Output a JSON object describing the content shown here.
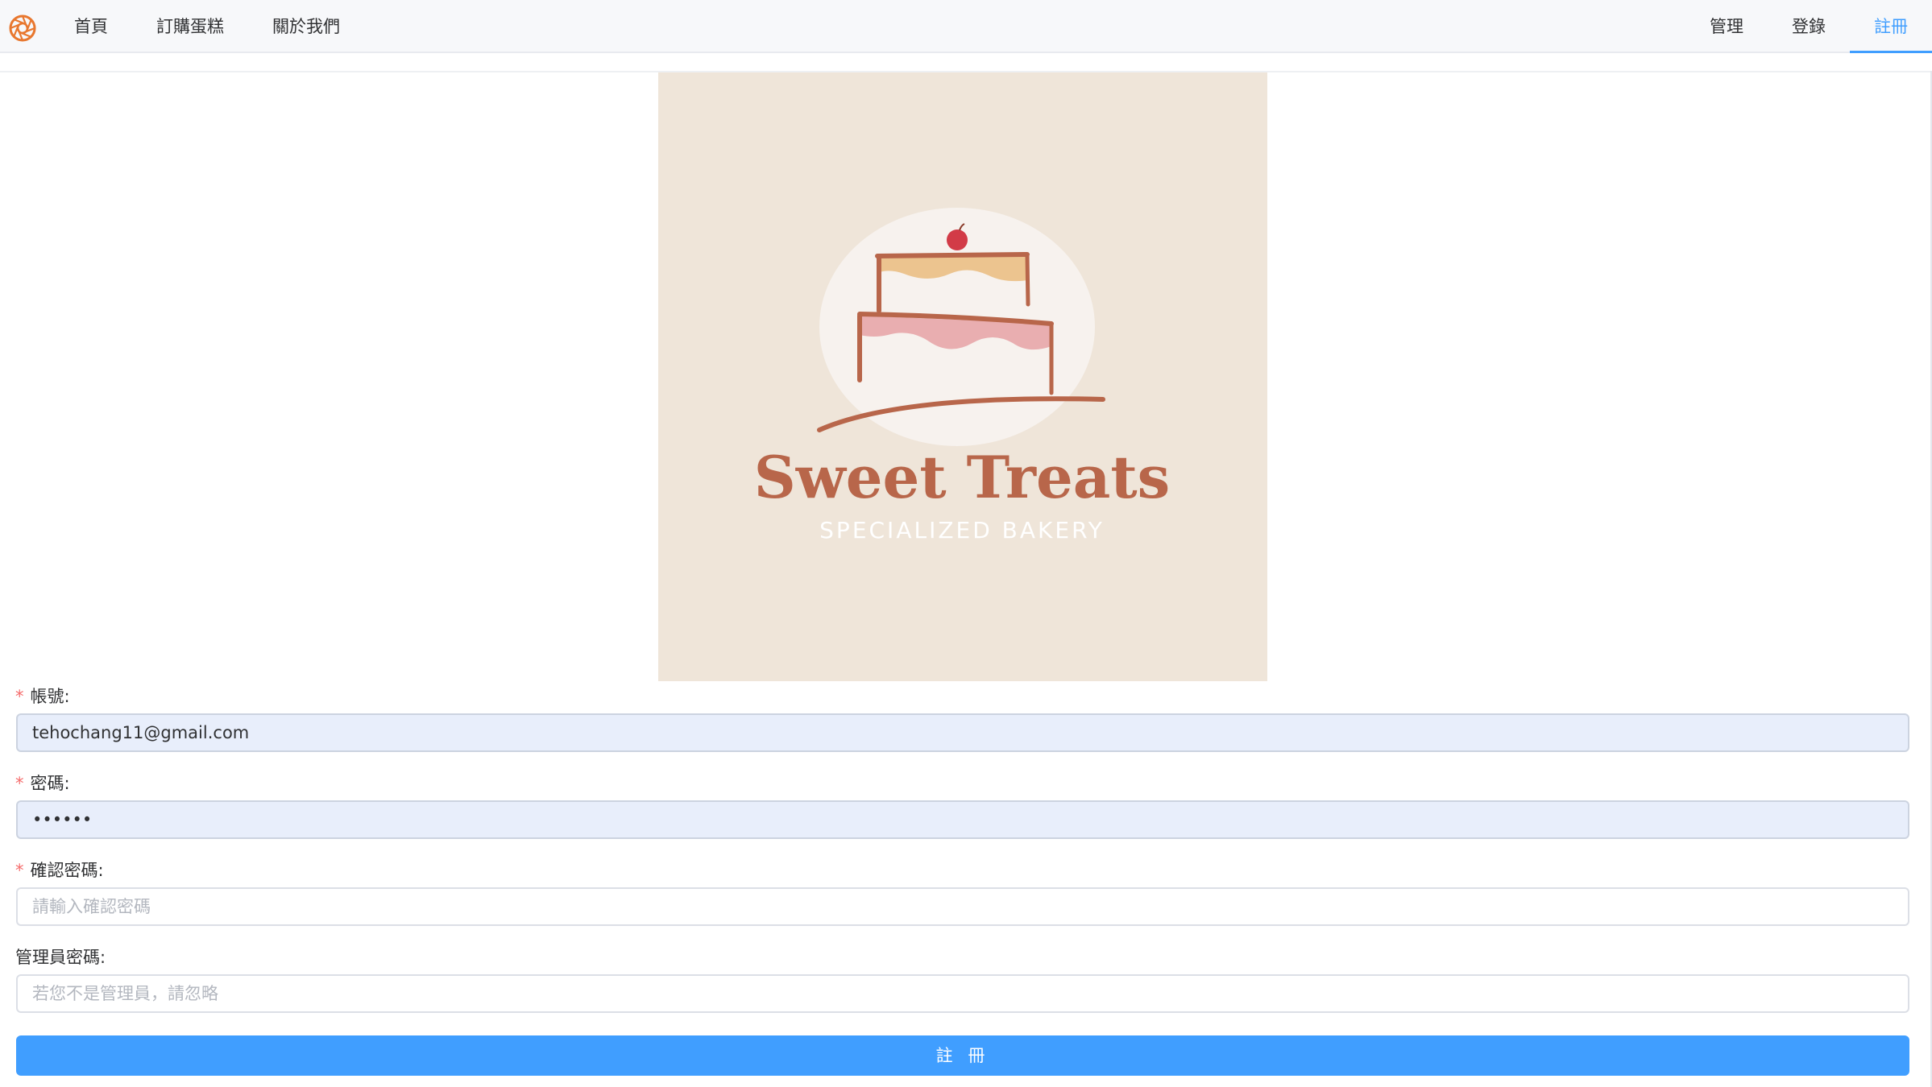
{
  "nav": {
    "left_items": [
      "首頁",
      "訂購蛋糕",
      "關於我們"
    ],
    "right_items": [
      "管理",
      "登錄",
      "註冊"
    ],
    "active_item": "註冊"
  },
  "hero": {
    "brand": "Sweet Treats",
    "tagline": "SPECIALIZED BAKERY"
  },
  "form": {
    "account": {
      "label": "帳號:",
      "value": "tehochang11@gmail.com",
      "required": true
    },
    "password": {
      "label": "密碼:",
      "value": "••••••",
      "required": true
    },
    "confirm_password": {
      "label": "確認密碼:",
      "placeholder": "請輸入確認密碼",
      "required": true
    },
    "admin_password": {
      "label": "管理員密碼:",
      "placeholder": "若您不是管理員，請忽略",
      "required": false
    },
    "required_mark": "*",
    "submit_label": "註 冊"
  },
  "colors": {
    "primary": "#409eff",
    "required": "#f56c6c",
    "hero_bg": "#efe5d9",
    "brand_text": "#b8664a",
    "autofill_bg": "#e8eefb"
  }
}
